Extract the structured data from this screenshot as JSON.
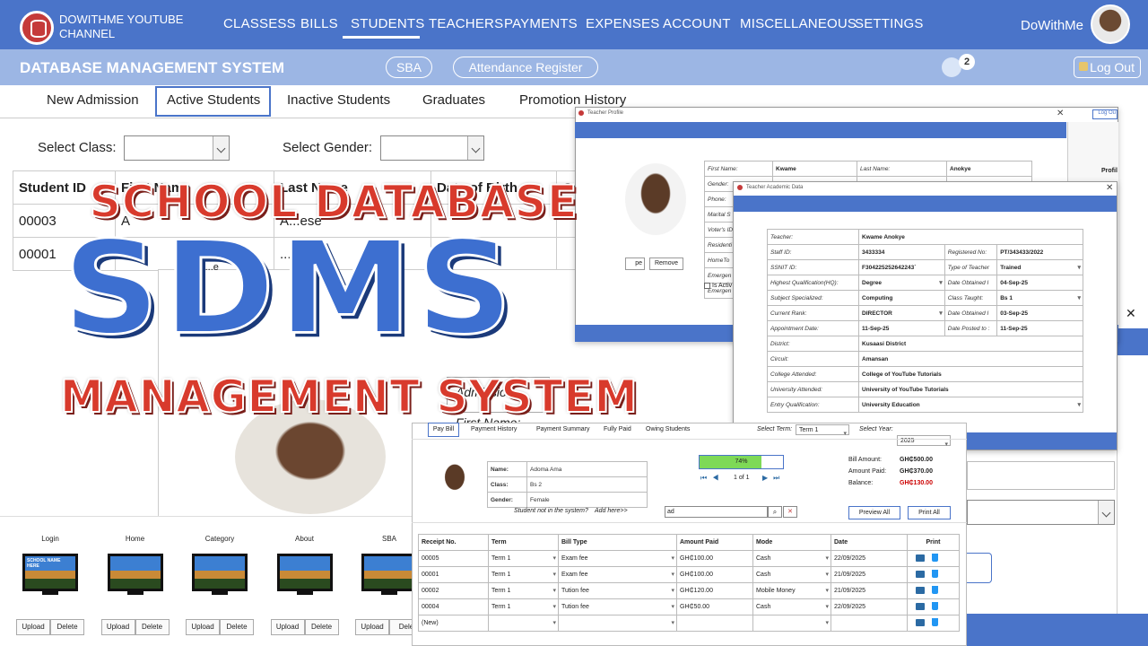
{
  "nav": {
    "channel": "DOWITHME YOUTUBE CHANNEL",
    "items": [
      "CLASSESS",
      "BILLS",
      "STUDENTS",
      "TEACHERS",
      "PAYMENTS",
      "EXPENSES",
      "ACCOUNT",
      "MISCELLANEOUS",
      "SETTINGS"
    ],
    "active": "STUDENTS",
    "user": "DoWithMe"
  },
  "subbar": {
    "title": "DATABASE MANAGEMENT SYSTEM",
    "sba": "SBA",
    "attendance": "Attendance Register",
    "notifications": "2",
    "logout": "Log Out"
  },
  "tabs": [
    "New Admission",
    "Active Students",
    "Inactive Students",
    "Graduates",
    "Promotion History"
  ],
  "filters": {
    "class_label": "Select Class:",
    "gender_label": "Select Gender:"
  },
  "students": {
    "headers": [
      "Student ID",
      "First Name",
      "Last Name",
      "Date of Birth",
      "Ge"
    ],
    "rows": [
      [
        "00003",
        "A",
        "A...ese",
        "",
        ""
      ],
      [
        "00001",
        "",
        "...b",
        "2...0",
        ""
      ]
    ]
  },
  "overlay": {
    "line1": "SCHOOL DATABASE",
    "line2": "SDMS",
    "line3": "MANAGEMENT SYSTEM"
  },
  "teacher_profile": {
    "title": "Teacher Profile",
    "first_name_l": "First Name:",
    "first_name": "Kwame",
    "last_name_l": "Last Name:",
    "last_name": "Anokye",
    "gender_l": "Gender:",
    "gender": "Male",
    "dob_l": "Date of Birth:",
    "dob": "21-Sep-02",
    "phone_l": "Phone:",
    "marital_l": "Marital S",
    "voter_l": "Voter's ID",
    "resident_l": "Residenti",
    "hometown_l": "HomeTo",
    "emergency1_l": "Emergen",
    "emergency2_l": "Emergen",
    "remove": "Remove",
    "pe": "pe",
    "active": "Is Activ",
    "logout": "Log Ou",
    "profile": "Profil"
  },
  "academic": {
    "title": "Teacher Academic Data",
    "rows": [
      [
        "Teacher:",
        "Kwame Anokye"
      ],
      [
        "Staff ID:",
        "3433334",
        "Registered No:",
        "PT/343433/2022"
      ],
      [
        "SSNIT ID:",
        "F304225252642243`",
        "Type of Teacher",
        "Trained"
      ],
      [
        "Highest Qualification(HQ):",
        "Degree",
        "Date Obtained I",
        "04-Sep-25"
      ],
      [
        "Subject Specialized:",
        "Computing",
        "Class Taught:",
        "Bs 1"
      ],
      [
        "Current Rank:",
        "DIRECTOR",
        "Date Obtained I",
        "03-Sep-25"
      ],
      [
        "Appointment Date:",
        "11-Sep-25",
        "Date Posted to :",
        "11-Sep-25"
      ],
      [
        "District:",
        "Kusaasi District"
      ],
      [
        "Circuit:",
        "Amansan"
      ],
      [
        "College Attended:",
        "College of YouTube Tutorials"
      ],
      [
        "University Attended:",
        "University of YouTube Tutorials"
      ],
      [
        "Entry Qualification:",
        "University Education"
      ]
    ]
  },
  "student_form": {
    "admission_l": "Admission",
    "first_name_l": "First Name:",
    "student_partial": "Stud...e"
  },
  "billing": {
    "tabs": [
      "Pay Bill",
      "Payment History",
      "Payment Summary",
      "Fully Paid",
      "Owing Students"
    ],
    "term_l": "Select Term:",
    "term": "Term 1",
    "year_l": "Select Year:",
    "year": "2025",
    "name_l": "Name:",
    "name": "Adoma Ama",
    "class_l": "Class:",
    "class": "Bs 2",
    "gender_l": "Gender:",
    "gender": "Female",
    "progress": "74%",
    "progress_value": 0.74,
    "pager": "1 of 1",
    "bill_l": "Bill Amount:",
    "bill": "GH₵500.00",
    "paid_l": "Amount Paid:",
    "paid": "GH₵370.00",
    "balance_l": "Balance:",
    "balance": "GH₵130.00",
    "not_in_system": "Student not in the system?",
    "add_here": "Add here>>",
    "search_value": "ad",
    "preview_all": "Preview All",
    "print_all": "Print All",
    "headers": [
      "Receipt No.",
      "Term",
      "Bill Type",
      "Amount Paid",
      "Mode",
      "Date",
      "Print"
    ],
    "rows": [
      [
        "00005",
        "Term 1",
        "Exam fee",
        "GH₵100.00",
        "Cash",
        "22/09/2025"
      ],
      [
        "00001",
        "Term 1",
        "Exam fee",
        "GH₵100.00",
        "Cash",
        "21/09/2025"
      ],
      [
        "00002",
        "Term 1",
        "Tution fee",
        "GH₵120.00",
        "Mobile Money",
        "21/09/2025"
      ],
      [
        "00004",
        "Term 1",
        "Tution fee",
        "GH₵50.00",
        "Cash",
        "22/09/2025"
      ],
      [
        "(New)",
        "",
        "",
        "",
        "",
        ""
      ]
    ]
  },
  "gallery": {
    "items": [
      "Login",
      "Home",
      "Category",
      "About",
      "SBA"
    ],
    "upload": "Upload",
    "delete": "Delete",
    "dele": "Dele",
    "screen_text": "SCHOOL NAME HERE"
  },
  "colors": {
    "primary": "#4a74c9",
    "subbar": "#9cb6e4",
    "overlay_red": "#d83a2c",
    "overlay_blue": "#3d6fd0",
    "balance": "#cc0000",
    "progress": "#7ed957"
  }
}
